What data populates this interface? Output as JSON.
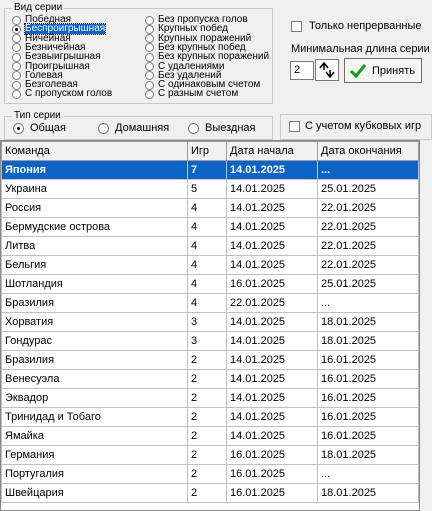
{
  "series_type_group": {
    "title": "Вид серии",
    "col1": [
      "Победная",
      "Беспроигрышная",
      "Ничейная",
      "Безничейная",
      "Безвыигрышная",
      "Проигрышная",
      "Голевая",
      "Безголевая",
      "С пропуском голов"
    ],
    "col2": [
      "Без пропуска голов",
      "Крупных побед",
      "Крупных поражений",
      "Без крупных побед",
      "Без крупных поражений",
      "С удалениями",
      "Без удалений",
      "С одинаковым счетом",
      "С разным счетом"
    ],
    "selected": "Беспроигрышная"
  },
  "continuous_only_label": "Только непрерванные",
  "min_length_label": "Минимальная длина серии",
  "min_length_value": "2",
  "apply_label": "Принять",
  "game_type_group": {
    "title": "Тип серии",
    "options": [
      "Общая",
      "Домашняя",
      "Выездная"
    ],
    "selected": "Общая"
  },
  "cup_games_label": "С учетом кубковых игр",
  "table": {
    "columns": [
      "Команда",
      "Игр",
      "Дата начала",
      "Дата окончания"
    ],
    "rows": [
      [
        "Япония",
        "7",
        "14.01.2025",
        "..."
      ],
      [
        "Украина",
        "5",
        "14.01.2025",
        "25.01.2025"
      ],
      [
        "Россия",
        "4",
        "14.01.2025",
        "22.01.2025"
      ],
      [
        "Бермудские острова",
        "4",
        "14.01.2025",
        "22.01.2025"
      ],
      [
        "Литва",
        "4",
        "14.01.2025",
        "22.01.2025"
      ],
      [
        "Бельгия",
        "4",
        "14.01.2025",
        "22.01.2025"
      ],
      [
        "Шотландия",
        "4",
        "16.01.2025",
        "25.01.2025"
      ],
      [
        "Бразилия",
        "4",
        "22.01.2025",
        "..."
      ],
      [
        "Хорватия",
        "3",
        "14.01.2025",
        "18.01.2025"
      ],
      [
        "Гондурас",
        "3",
        "14.01.2025",
        "18.01.2025"
      ],
      [
        "Бразилия",
        "2",
        "14.01.2025",
        "16.01.2025"
      ],
      [
        "Венесуэла",
        "2",
        "14.01.2025",
        "16.01.2025"
      ],
      [
        "Эквадор",
        "2",
        "14.01.2025",
        "16.01.2025"
      ],
      [
        "Тринидад и Тобаго",
        "2",
        "14.01.2025",
        "16.01.2025"
      ],
      [
        "Ямайка",
        "2",
        "14.01.2025",
        "16.01.2025"
      ],
      [
        "Германия",
        "2",
        "16.01.2025",
        "18.01.2025"
      ],
      [
        "Португалия",
        "2",
        "16.01.2025",
        "..."
      ],
      [
        "Швейцария",
        "2",
        "16.01.2025",
        "18.01.2025"
      ]
    ],
    "selected_row": 0
  }
}
